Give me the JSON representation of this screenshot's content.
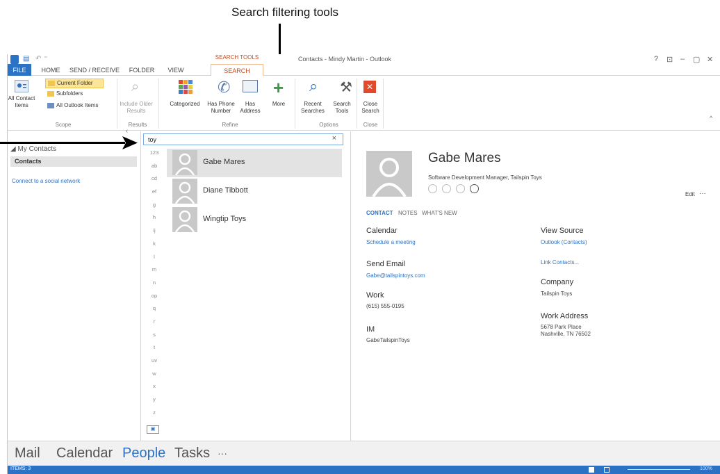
{
  "annotation": {
    "callout": "Search filtering tools"
  },
  "window": {
    "title": "Contacts - Mindy Martin - Outlook",
    "context_label": "SEARCH TOOLS",
    "controls": {
      "help": "?",
      "restore_ribbon": "⊡",
      "minimize": "–",
      "maximize": "▢",
      "close": "✕"
    }
  },
  "tabs": [
    "FILE",
    "HOME",
    "SEND / RECEIVE",
    "FOLDER",
    "VIEW",
    "SEARCH"
  ],
  "ribbon": {
    "scope": {
      "label": "Scope",
      "all_contact_items": "All Contact Items",
      "current_folder": "Current Folder",
      "subfolders": "Subfolders",
      "all_outlook_items": "All Outlook Items"
    },
    "results": {
      "label": "Results",
      "include_older": "Include Older Results"
    },
    "refine": {
      "label": "Refine",
      "categorized": "Categorized",
      "has_phone_number": "Has Phone Number",
      "has_address": "Has Address",
      "more": "More"
    },
    "options": {
      "label": "Options",
      "recent_searches": "Recent Searches",
      "search_tools": "Search Tools"
    },
    "close": {
      "label": "Close",
      "close_search": "Close Search"
    }
  },
  "nav": {
    "my_contacts": "◢ My Contacts",
    "contacts": "Contacts",
    "connect": "Connect to a social network"
  },
  "search": {
    "value": "toy",
    "clear": "×"
  },
  "alpha_index": [
    "123",
    "ab",
    "cd",
    "ef",
    "g",
    "h",
    "ij",
    "k",
    "l",
    "m",
    "n",
    "op",
    "q",
    "r",
    "s",
    "t",
    "uv",
    "w",
    "x",
    "y",
    "z"
  ],
  "contacts_list": [
    {
      "name": "Gabe Mares",
      "selected": true
    },
    {
      "name": "Diane Tibbott",
      "selected": false
    },
    {
      "name": "Wingtip Toys",
      "selected": false
    }
  ],
  "contact": {
    "name": "Gabe Mares",
    "title": "Software Development Manager, Tailspin Toys",
    "edit": "Edit",
    "more": "···",
    "tabs": [
      "CONTACT",
      "NOTES",
      "WHAT'S NEW"
    ],
    "calendar_heading": "Calendar",
    "calendar_link": "Schedule a meeting",
    "send_email_heading": "Send Email",
    "email": "Gabe@tailspintoys.com",
    "work_heading": "Work",
    "work_phone": "(615) 555-0195",
    "im_heading": "IM",
    "im_value": "GabeTailspinToys",
    "view_source_heading": "View Source",
    "view_source_link": "Outlook (Contacts)",
    "link_contacts": "Link Contacts...",
    "company_heading": "Company",
    "company_value": "Tailspin Toys",
    "work_address_heading": "Work Address",
    "work_address_line1": "5678 Park Place",
    "work_address_line2": "Nashville, TN 76502"
  },
  "bottom_nav": [
    "Mail",
    "Calendar",
    "People",
    "Tasks",
    "···"
  ],
  "status": {
    "items": "ITEMS: 3",
    "zoom": "100%"
  },
  "colors": {
    "accent": "#2b72c5",
    "context": "#c74a1b",
    "selected_row": "#e3e3e3"
  }
}
